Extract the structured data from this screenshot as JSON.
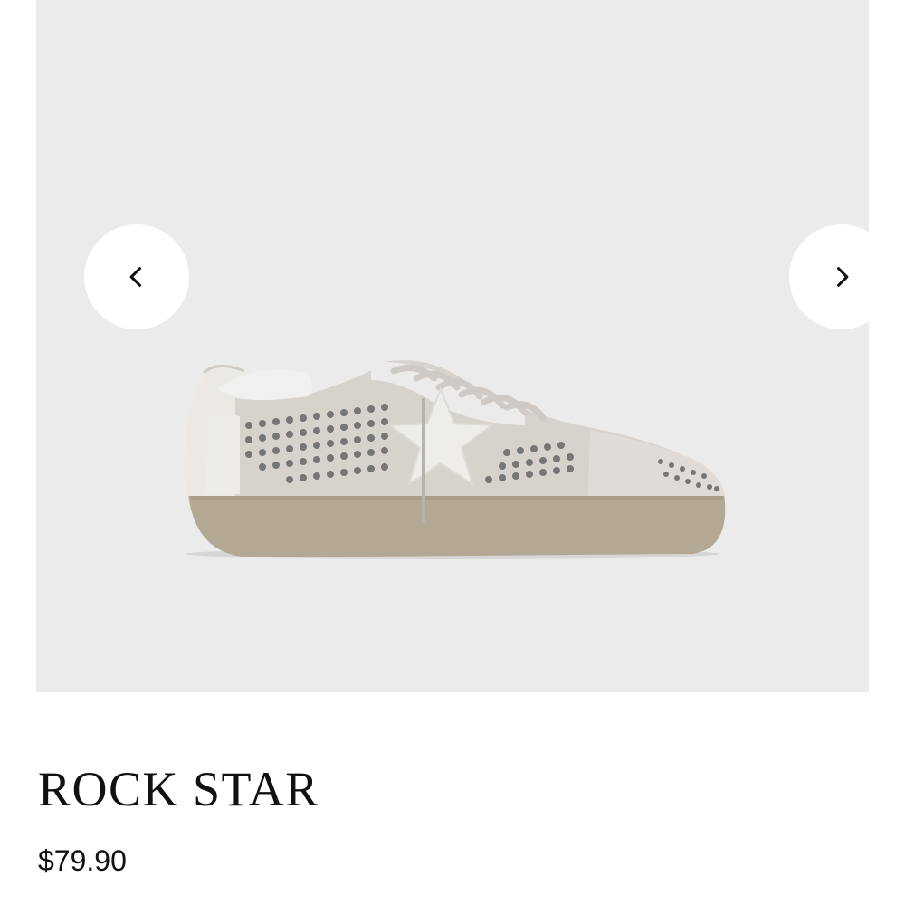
{
  "product": {
    "title": "ROCK STAR",
    "price": "$79.90"
  },
  "gallery": {
    "background_color": "#ebebeb",
    "prev_icon": "chevron-left-icon",
    "next_icon": "chevron-right-icon"
  }
}
